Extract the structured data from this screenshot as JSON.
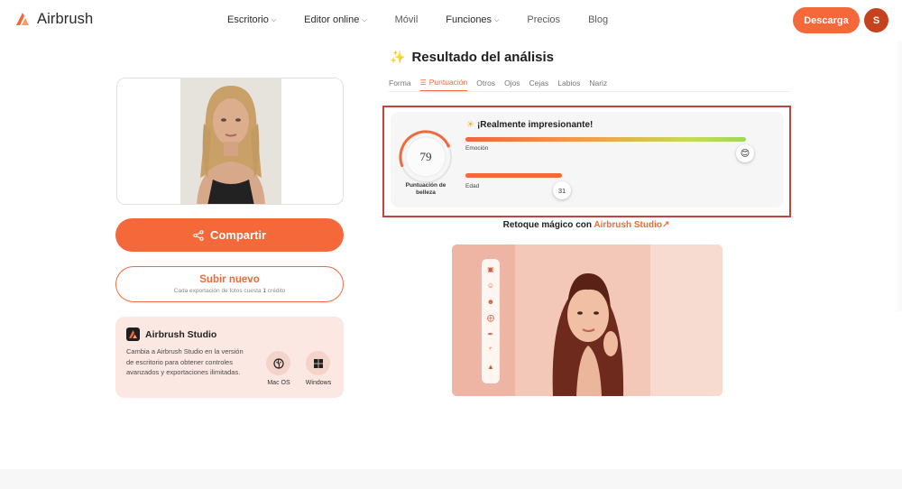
{
  "header": {
    "logo_text": "Airbrush",
    "nav": [
      {
        "label": "Escritorio",
        "chevron": true
      },
      {
        "label": "Editor online",
        "chevron": true
      },
      {
        "label": "Móvil",
        "chevron": false
      },
      {
        "label": "Funciones",
        "chevron": true
      },
      {
        "label": "Precios",
        "chevron": false
      },
      {
        "label": "Blog",
        "chevron": false
      }
    ],
    "download_label": "Descarga",
    "avatar_initial": "S"
  },
  "left": {
    "share_label": "Compartir",
    "upload_title": "Subir nuevo",
    "upload_sub_prefix": "Cada exportación de fotos cuesta",
    "upload_sub_count": "1",
    "upload_sub_suffix": "crédito",
    "studio": {
      "title": "Airbrush Studio",
      "description": "Cambia a Airbrush Studio en la versión de escritorio para obtener controles avanzados y exportaciones ilimitadas.",
      "mac_label": "Mac OS",
      "windows_label": "Windows"
    }
  },
  "analysis": {
    "title": "Resultado del análisis",
    "tabs": [
      "Forma",
      "Puntuación",
      "Otros",
      "Ojos",
      "Cejas",
      "Labios",
      "Nariz"
    ],
    "active_tab": "Puntuación",
    "score": "79",
    "score_fraction": 0.79,
    "score_label": "Puntuación de belleza",
    "headline": "¡Realmente impresionante!",
    "emotion_label": "Emoción",
    "emotion_fraction": 1.0,
    "age_label": "Edad",
    "age_value": "31",
    "retouch_prefix": "Retoque mágico con",
    "retouch_link": "Airbrush Studio",
    "retouch_arrow": "↗"
  },
  "colors": {
    "accent": "#f4683a",
    "highlight_border": "#c2443c",
    "studio_bg": "#fce8e2"
  }
}
